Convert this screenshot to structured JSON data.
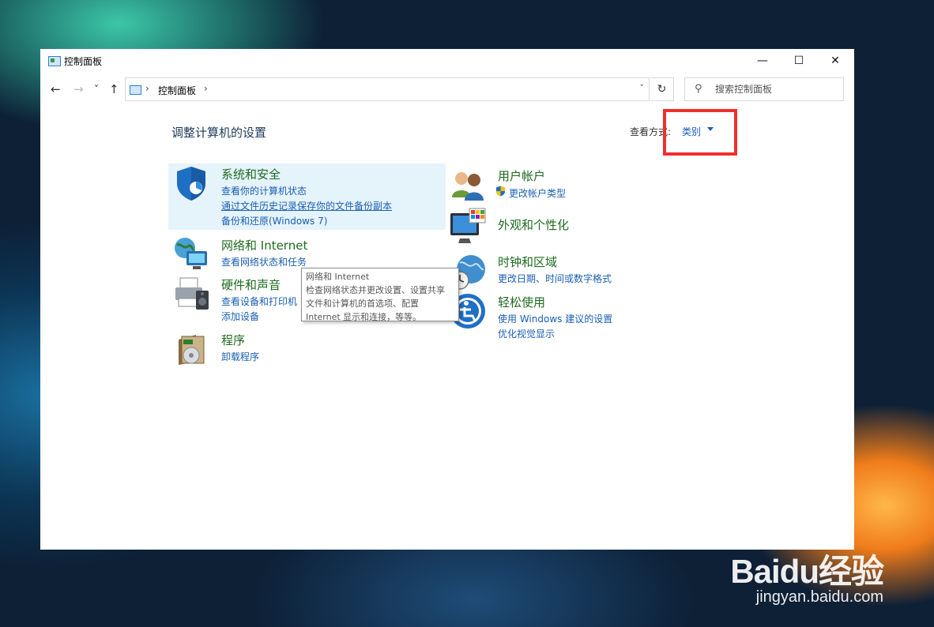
{
  "window": {
    "title": "控制面板",
    "minimize_glyph": "—",
    "maximize_glyph": "☐",
    "close_glyph": "✕"
  },
  "nav": {
    "back_glyph": "←",
    "forward_glyph": "→",
    "recent_glyph": "˅",
    "up_glyph": "↑"
  },
  "address": {
    "separator": "›",
    "crumbs": [
      "控制面板"
    ],
    "dropdown_glyph": "˅",
    "refresh_glyph": "↻"
  },
  "search": {
    "placeholder": "搜索控制面板",
    "icon_glyph": "⚲"
  },
  "page_title": "调整计算机的设置",
  "view_by": {
    "label": "查看方式:",
    "value": "类别"
  },
  "left_categories": [
    {
      "name": "系统和安全",
      "icon": "shield-icon",
      "links": [
        "查看你的计算机状态",
        "通过文件历史记录保存你的文件备份副本",
        "备份和还原(Windows 7)"
      ]
    },
    {
      "name": "网络和 Internet",
      "icon": "network-globe-icon",
      "links": [
        "查看网络状态和任务"
      ]
    },
    {
      "name": "硬件和声音",
      "icon": "printer-icon",
      "links": [
        "查看设备和打印机",
        "添加设备"
      ]
    },
    {
      "name": "程序",
      "icon": "programs-icon",
      "links": [
        "卸载程序"
      ]
    }
  ],
  "right_categories": [
    {
      "name": "用户帐户",
      "icon": "users-icon",
      "links": [
        "更改帐户类型"
      ]
    },
    {
      "name": "外观和个性化",
      "icon": "monitor-palette-icon",
      "links": []
    },
    {
      "name": "时钟和区域",
      "icon": "clock-globe-icon",
      "links": [
        "更改日期、时间或数字格式"
      ]
    },
    {
      "name": "轻松使用",
      "icon": "ease-of-access-icon",
      "links": [
        "使用 Windows 建议的设置",
        "优化视觉显示"
      ]
    }
  ],
  "tooltip": {
    "lines": [
      "网络和 Internet",
      "检查网络状态并更改设置、设置共享",
      "文件和计算机的首选项、配置",
      "Internet 显示和连接，等等。"
    ]
  },
  "watermark": {
    "brand": "Baidu经验",
    "url": "jingyan.baidu.com"
  },
  "colors": {
    "link": "#1a5fb4",
    "category_heading": "#1d6b1f",
    "highlight": "#e5f3fb",
    "annotation_box": "#ee2f2f"
  }
}
